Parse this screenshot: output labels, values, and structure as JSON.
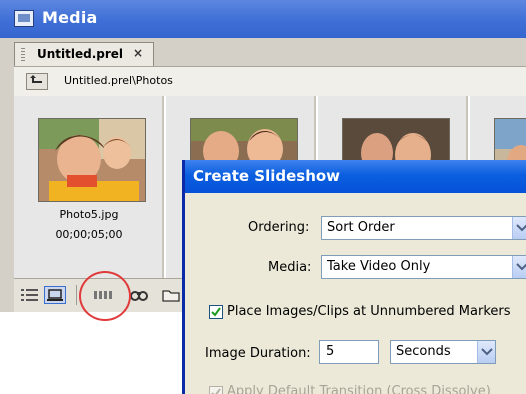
{
  "panel": {
    "title": "Media",
    "tab_label": "Untitled.prel",
    "tab_close": "×",
    "path": "Untitled.prel\\Photos",
    "items": [
      {
        "name": "Photo5.jpg",
        "duration": "00;00;05;00"
      },
      {
        "name": "",
        "duration": ""
      },
      {
        "name": "",
        "duration": ""
      },
      {
        "name": "",
        "duration": ""
      }
    ],
    "view_buttons": [
      "list-view-icon",
      "icon-view-icon",
      "storyboard-icon",
      "find-icon",
      "new-bin-icon"
    ]
  },
  "dialog": {
    "title": "Create Slideshow",
    "ordering_label": "Ordering:",
    "ordering_value": "Sort Order",
    "media_label": "Media:",
    "media_value": "Take Video Only",
    "place_markers_label": "Place Images/Clips at Unnumbered Markers",
    "place_markers_checked": true,
    "image_duration_label": "Image Duration:",
    "image_duration_value": "5",
    "duration_unit": "Seconds",
    "apply_transition_label": "Apply Default Transition (Cross Dissolve)",
    "apply_transition_checked": true,
    "apply_transition_enabled": false
  },
  "colors": {
    "title_blue": "#3f6fd6",
    "dialog_title_blue": "#0b5fe0",
    "highlight_red": "#e03a3a"
  }
}
